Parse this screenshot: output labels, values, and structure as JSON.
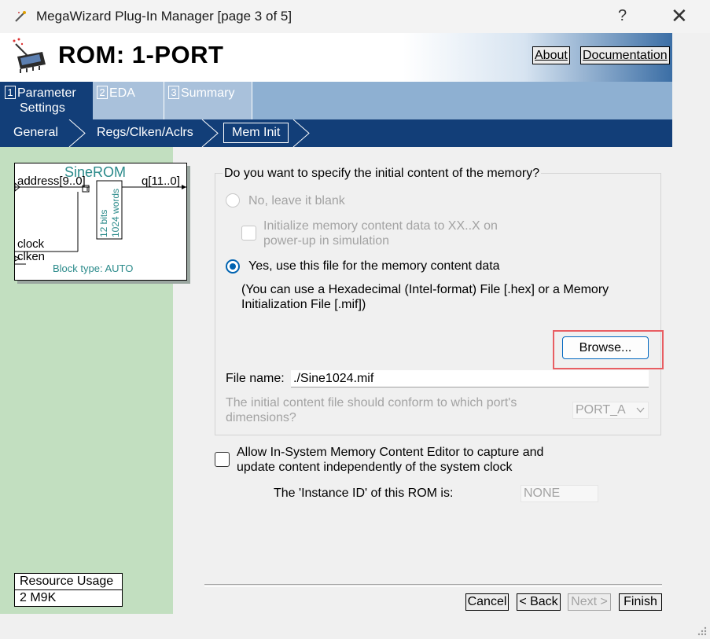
{
  "window": {
    "title": "MegaWizard Plug-In Manager [page 3 of 5]",
    "help_label": "?",
    "close_label": "✕"
  },
  "header": {
    "title": "ROM: 1-PORT",
    "about_label": "About",
    "documentation_label": "Documentation"
  },
  "tabs": [
    {
      "num": "1",
      "line1": "Parameter",
      "line2": "Settings",
      "active": true
    },
    {
      "num": "2",
      "line1": "EDA",
      "active": false
    },
    {
      "num": "3",
      "line1": "Summary",
      "active": false
    }
  ],
  "subtabs": [
    {
      "label": "General"
    },
    {
      "label": "Regs/Clken/Aclrs"
    },
    {
      "label": "Mem Init",
      "active": true
    }
  ],
  "symbol": {
    "name": "SineROM",
    "port_address": "address[9..0]",
    "port_q": "q[11..0]",
    "port_clock": "clock",
    "port_clken": "clken",
    "bits": "12 bits",
    "words": "1024 words",
    "block_type": "Block type: AUTO"
  },
  "resource": {
    "header": "Resource Usage",
    "value": "2 M9K"
  },
  "memory_init": {
    "question": "Do you want to specify the initial content of the memory?",
    "option_blank": "No, leave it blank",
    "init_xx_line1": "Initialize memory content data to XX..X on",
    "init_xx_line2": "power-up in simulation",
    "option_file": "Yes, use this file for the memory content data",
    "file_hint_line1": "(You can use a Hexadecimal (Intel-format) File [.hex] or a Memory",
    "file_hint_line2": "Initialization File [.mif])",
    "browse_label": "Browse...",
    "file_name_label": "File name:",
    "file_name_value": "./Sine1024.mif",
    "port_question_line1": "The initial content file should conform to which port's",
    "port_question_line2": "dimensions?",
    "port_value": "PORT_A"
  },
  "in_system": {
    "label_line1": "Allow In-System Memory Content Editor to capture and",
    "label_line2": "update content independently of the system clock",
    "instance_label": "The 'Instance ID' of this ROM is:",
    "instance_value": "NONE"
  },
  "nav": {
    "cancel": "Cancel",
    "back": "< Back",
    "next": "Next >",
    "finish": "Finish"
  },
  "colors": {
    "accent": "#0063b1",
    "tab_active": "#123e78",
    "highlight": "#e85e63",
    "left_panel": "#c2dfc0"
  }
}
